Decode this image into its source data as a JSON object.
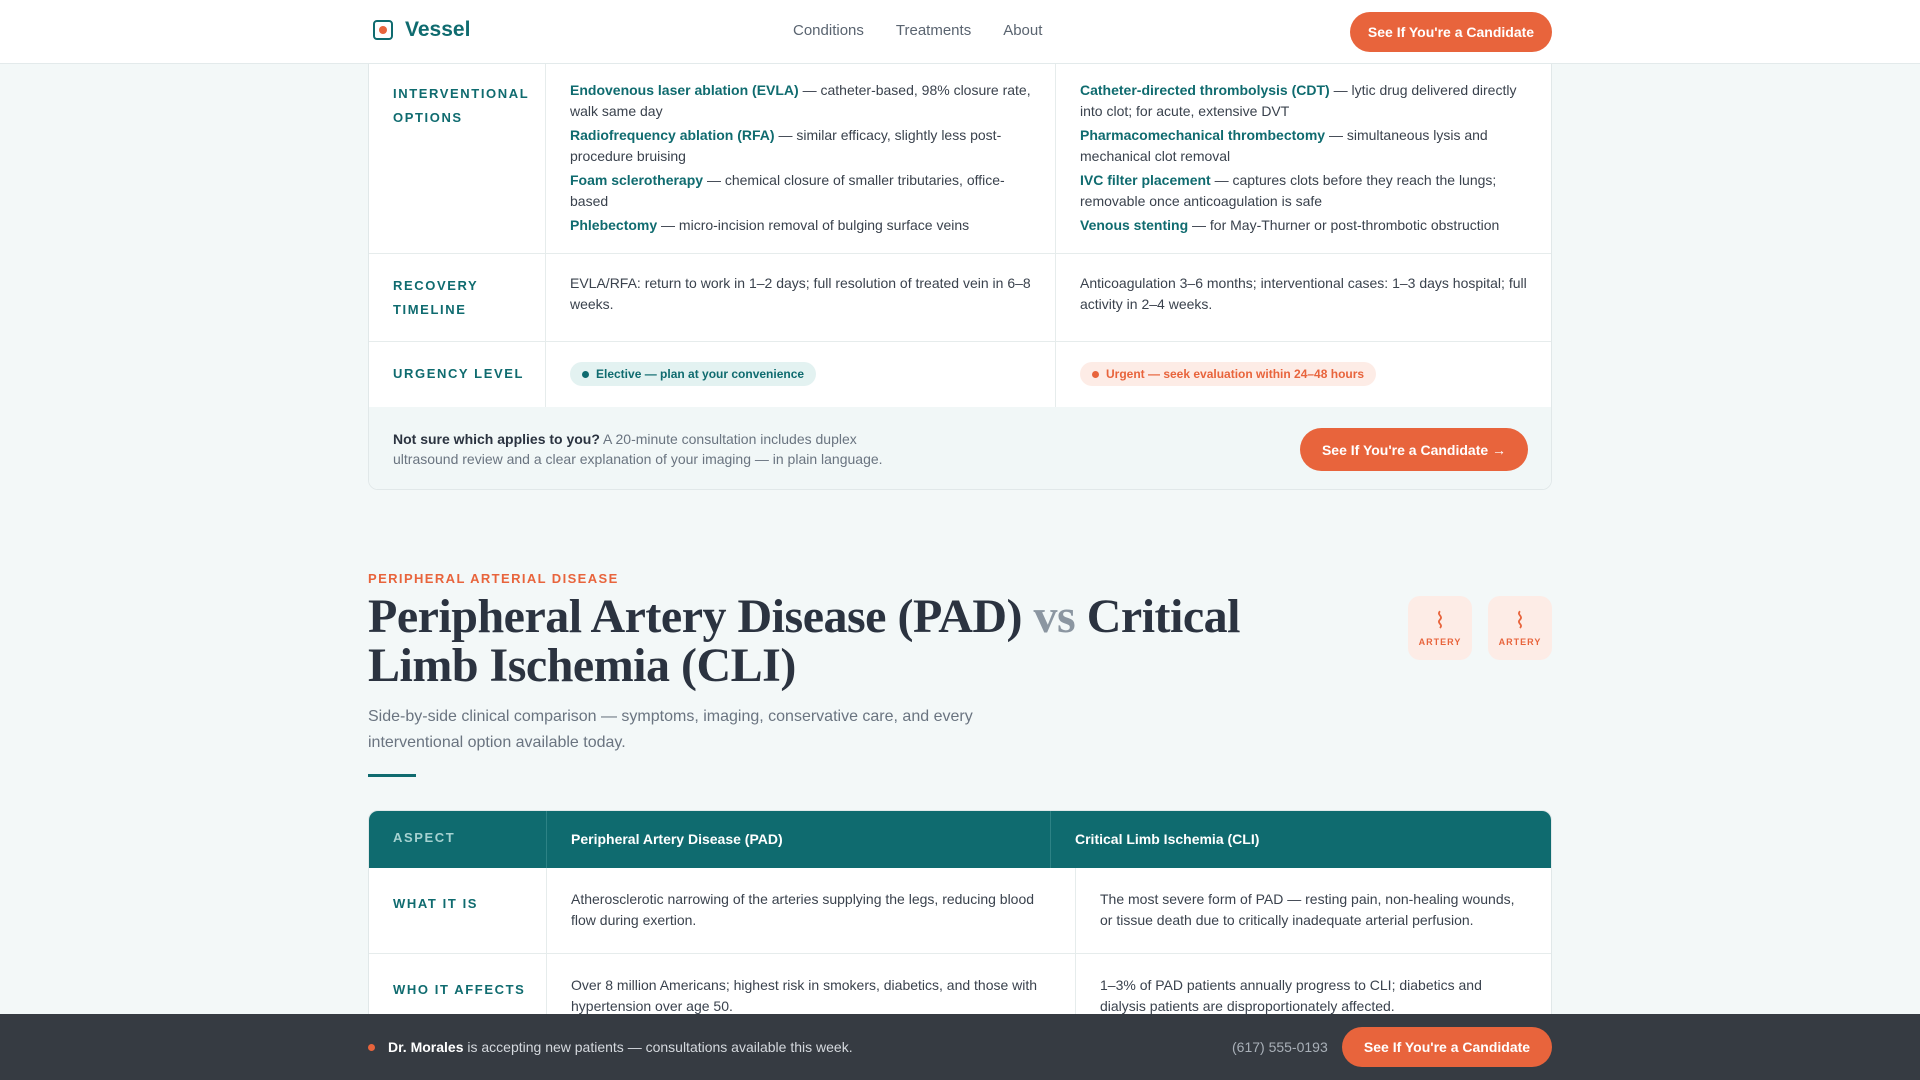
{
  "header": {
    "brand": "Vessel",
    "nav": [
      "Conditions",
      "Treatments",
      "About"
    ],
    "cta": "See If You're a Candidate"
  },
  "top_table": {
    "rows": {
      "interventional": {
        "aspect": "Interventional Options",
        "col1": [
          {
            "name": "Endovenous laser ablation (EVLA)",
            "desc": " — catheter-based, 98% closure rate, walk same day"
          },
          {
            "name": "Radiofrequency ablation (RFA)",
            "desc": " — similar efficacy, slightly less post-procedure bruising"
          },
          {
            "name": "Foam sclerotherapy",
            "desc": " — chemical closure of smaller tributaries, office-based"
          },
          {
            "name": "Phlebectomy",
            "desc": " — micro-incision removal of bulging surface veins"
          }
        ],
        "col2": [
          {
            "name": "Catheter-directed thrombolysis (CDT)",
            "desc": " — lytic drug delivered directly into clot; for acute, extensive DVT"
          },
          {
            "name": "Pharmacomechanical thrombectomy",
            "desc": " — simultaneous lysis and mechanical clot removal"
          },
          {
            "name": "IVC filter placement",
            "desc": " — captures clots before they reach the lungs; removable once anticoagulation is safe"
          },
          {
            "name": "Venous stenting",
            "desc": " — for May-Thurner or post-thrombotic obstruction"
          }
        ]
      },
      "recovery": {
        "aspect": "Recovery Timeline",
        "col1": "EVLA/RFA: return to work in 1–2 days; full resolution of treated vein in 6–8 weeks.",
        "col2": "Anticoagulation 3–6 months; interventional cases: 1–3 days hospital; full activity in 2–4 weeks."
      },
      "urgency": {
        "aspect": "Urgency Level",
        "col1": "Elective — plan at your convenience",
        "col2": "Urgent — seek evaluation within 24–48 hours"
      }
    },
    "consult": {
      "lead": "Not sure which applies to you?",
      "body": " A 20-minute consultation includes duplex ultrasound review and a clear explanation of your imaging — in plain language.",
      "cta": "See If You're a Candidate →"
    }
  },
  "section": {
    "eyebrow": "PERIPHERAL ARTERIAL DISEASE",
    "title_a": "Peripheral Artery Disease (PAD)",
    "title_vs": "vs",
    "title_b": "Critical Limb Ischemia (CLI)",
    "subtitle": "Side-by-side clinical comparison — symptoms, imaging, conservative care, and every interventional option available today.",
    "tiles": [
      "ARTERY",
      "ARTERY"
    ]
  },
  "table2": {
    "headers": {
      "aspect": "ASPECT",
      "col1": "Peripheral Artery Disease (PAD)",
      "col2": "Critical Limb Ischemia (CLI)"
    },
    "rows": [
      {
        "aspect": "What It Is",
        "col1": "Atherosclerotic narrowing of the arteries supplying the legs, reducing blood flow during exertion.",
        "col2": "The most severe form of PAD — resting pain, non-healing wounds, or tissue death due to critically inadequate arterial perfusion."
      },
      {
        "aspect": "Who It Affects",
        "col1": "Over 8 million Americans; highest risk in smokers, diabetics, and those with hypertension over age 50.",
        "col2": "1–3% of PAD patients annually progress to CLI; diabetics and dialysis patients are disproportionately affected."
      }
    ]
  },
  "bottom_bar": {
    "doctor": "Dr. Morales",
    "message": " is accepting new patients — consultations available this week.",
    "phone": "(617) 555-0193",
    "cta": "See If You're a Candidate"
  },
  "colors": {
    "brand_teal": "#0f6b6f",
    "accent_orange": "#e8643c",
    "bar_dark": "#363b42"
  }
}
